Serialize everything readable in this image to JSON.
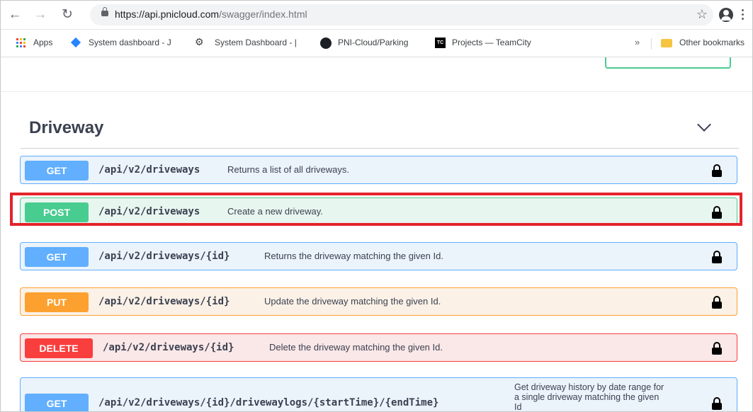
{
  "browser": {
    "url_host": "https://api.pnicloud.com",
    "url_path": "/swagger/index.html",
    "bookmarks": [
      {
        "label": "Apps",
        "icon": "apps-grid-icon"
      },
      {
        "label": "System dashboard - J",
        "icon": "jira-diamond-icon"
      },
      {
        "label": "System Dashboard - |",
        "icon": "jenkins-icon"
      },
      {
        "label": "PNI-Cloud/Parking",
        "icon": "github-icon"
      },
      {
        "label": "Projects — TeamCity",
        "icon": "teamcity-icon"
      }
    ],
    "overflow": "»",
    "other_bookmarks": "Other bookmarks"
  },
  "section": {
    "title": "Driveway"
  },
  "operations": [
    {
      "method": "GET",
      "path": "/api/v2/driveways",
      "summary": "Returns a list of all driveways.",
      "color": "#61affe"
    },
    {
      "method": "POST",
      "path": "/api/v2/driveways",
      "summary": "Create a new driveway.",
      "color": "#49cc90",
      "highlighted": true
    },
    {
      "method": "GET",
      "path": "/api/v2/driveways/{id}",
      "summary": "Returns the driveway matching the given Id.",
      "color": "#61affe"
    },
    {
      "method": "PUT",
      "path": "/api/v2/driveways/{id}",
      "summary": "Update the driveway matching the given Id.",
      "color": "#fca130"
    },
    {
      "method": "DELETE",
      "path": "/api/v2/driveways/{id}",
      "summary": "Delete the driveway matching the given Id.",
      "color": "#f93e3e"
    },
    {
      "method": "GET",
      "path": "/api/v2/driveways/{id}/drivewaylogs/{startTime}/{endTime}",
      "summary_line1": "Get driveway history by date range for",
      "summary_line2": "a single driveway matching the given",
      "summary_line3": "Id",
      "color": "#61affe"
    }
  ],
  "highlight_color": "#e3242b"
}
